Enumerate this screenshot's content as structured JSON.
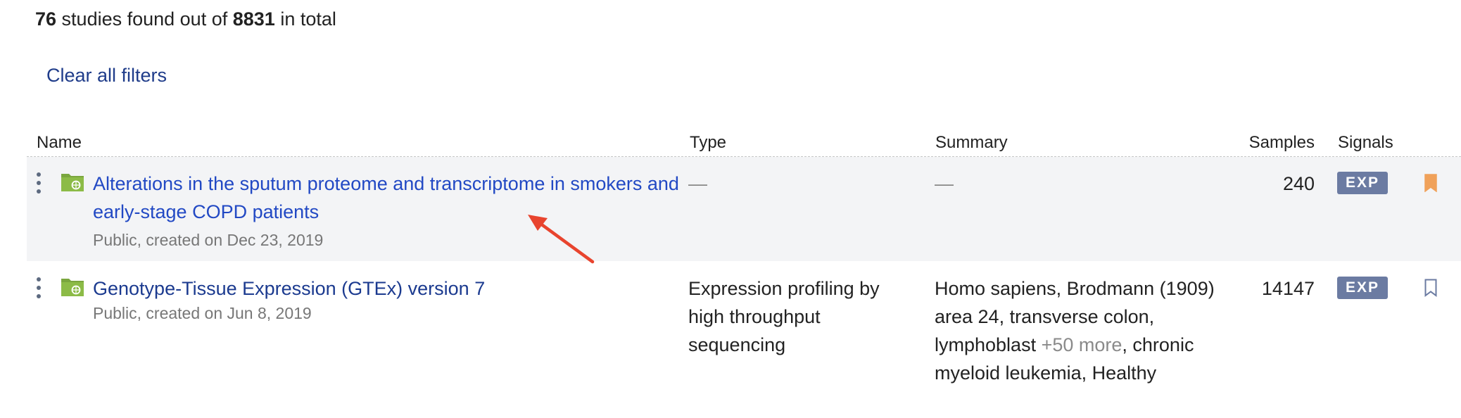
{
  "results": {
    "found_count": "76",
    "text_1": " studies found out of ",
    "total_count": "8831",
    "text_2": " in total"
  },
  "filters": {
    "clear_label": "Clear all filters"
  },
  "table": {
    "columns": {
      "name": "Name",
      "type": "Type",
      "summary": "Summary",
      "samples": "Samples",
      "signals": "Signals"
    },
    "rows": [
      {
        "title": "Alterations in the sputum proteome and transcriptome in smokers and early-stage COPD patients",
        "meta": "Public, created on Dec 23, 2019",
        "type": "—",
        "summary": "—",
        "samples": "240",
        "signal": "EXP",
        "bookmarked": true,
        "highlighted": true
      },
      {
        "title": "Genotype-Tissue Expression (GTEx) version 7",
        "meta": "Public, created on Jun 8, 2019",
        "type": "Expression profiling by high throughput sequencing",
        "summary_prefix": "Homo sapiens, Brodmann (1909) area 24, transverse colon, lymphoblast ",
        "summary_more": "+50 more",
        "summary_suffix": ", chronic myeloid leukemia, Healthy",
        "samples": "14147",
        "signal": "EXP",
        "bookmarked": false,
        "highlighted": false
      }
    ]
  },
  "colors": {
    "link": "#2249c4",
    "link_visited": "#1b3a8f",
    "badge_bg": "#6b7ba2",
    "bookmark_active": "#f0a15a",
    "bookmark_inactive": "#6b7ba2",
    "row_highlight": "#f3f4f6",
    "annotation_arrow": "#e8442e",
    "folder_green": "#7aa63e"
  },
  "icons": {
    "row_menu": "kebab-menu-icon",
    "study": "folder-icon",
    "bookmark": "bookmark-icon",
    "annotation": "arrow-icon"
  }
}
